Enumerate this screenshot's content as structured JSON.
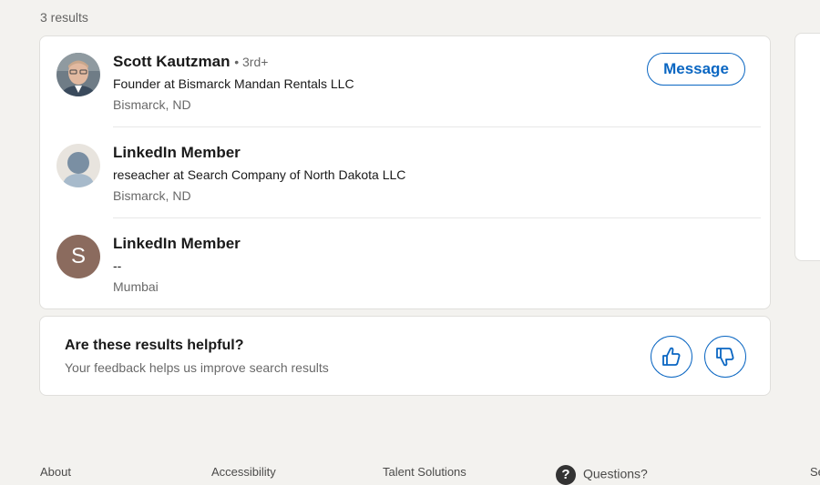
{
  "results_count": "3 results",
  "results": [
    {
      "name": "Scott Kautzman",
      "degree": "• 3rd+",
      "headline": "Founder at Bismarck Mandan Rentals LLC",
      "location": "Bismarck, ND",
      "action_label": "Message"
    },
    {
      "name": "LinkedIn Member",
      "headline": "reseacher at Search Company of North Dakota LLC",
      "location": "Bismarck, ND"
    },
    {
      "name": "LinkedIn Member",
      "avatar_letter": "S",
      "headline": "--",
      "location": "Mumbai"
    }
  ],
  "feedback": {
    "title": "Are these results helpful?",
    "subtitle": "Your feedback helps us improve search results"
  },
  "footer": {
    "links": [
      "About",
      "Accessibility",
      "Talent Solutions"
    ],
    "questions_label": "Questions?",
    "cut_label": "Se"
  },
  "colors": {
    "accent": "#0a66c2",
    "page_bg": "#f3f2ef"
  },
  "icons": {
    "thumbs_up": "thumbs-up-icon",
    "thumbs_down": "thumbs-down-icon",
    "question": "question-icon"
  }
}
